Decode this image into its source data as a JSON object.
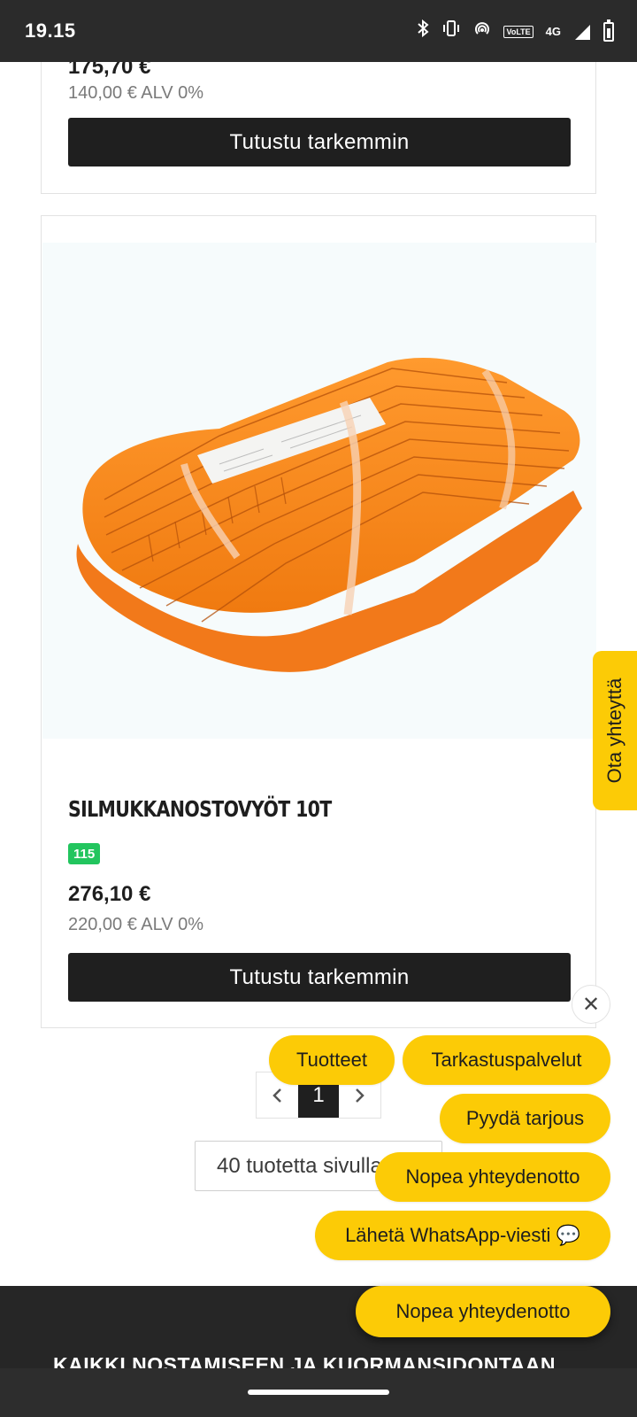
{
  "status_bar": {
    "time": "19.15",
    "lte_label": "VoLTE",
    "network": "4G"
  },
  "previous_product": {
    "price": "175,70 €",
    "price_vat0": "140,00 € ALV 0%",
    "cta_label": "Tutustu tarkemmin"
  },
  "product": {
    "title": "SILMUKKANOSTOVYÖT 10T",
    "stock_badge": "115",
    "price": "276,10 €",
    "price_vat0": "220,00 € ALV 0%",
    "cta_label": "Tutustu tarkemmin"
  },
  "side_tab": {
    "label": "Ota yhteyttä"
  },
  "pagination": {
    "current_page": "1"
  },
  "per_page": {
    "label": "40 tuotetta sivulla"
  },
  "contact_menu": {
    "items": [
      {
        "label": "Tuotteet"
      },
      {
        "label": "Tarkastuspalvelut"
      },
      {
        "label": "Pyydä tarjous"
      },
      {
        "label": "Nopea yhteydenotto"
      },
      {
        "label": "Lähetä WhatsApp-viesti 💬"
      }
    ],
    "main_button_label": "Nopea yhteydenotto"
  },
  "footer": {
    "heading": "KAIKKI NOSTAMISEEN JA KUORMANSIDONTAAN"
  },
  "colors": {
    "accent_yellow": "#fccb06",
    "stock_green": "#22c55e",
    "button_dark": "#1f1f1f",
    "product_orange": "#ff8a1f"
  }
}
